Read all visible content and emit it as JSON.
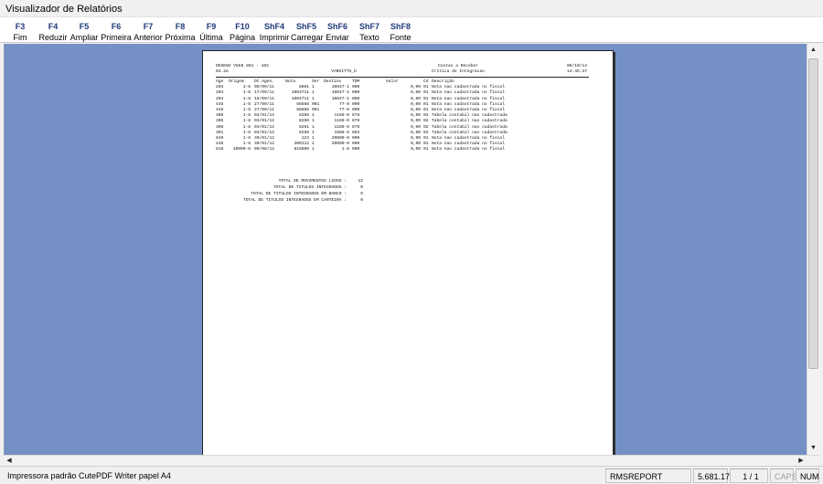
{
  "window": {
    "title": "Visualizador de Relatórios"
  },
  "toolbar": {
    "buttons": [
      {
        "key": "F3",
        "label": "Fim"
      },
      {
        "key": "F4",
        "label": "Reduzir"
      },
      {
        "key": "F5",
        "label": "Ampliar"
      },
      {
        "key": "F6",
        "label": "Primeira"
      },
      {
        "key": "F7",
        "label": "Anterior"
      },
      {
        "key": "F8",
        "label": "Próxima"
      },
      {
        "key": "F9",
        "label": "Última"
      },
      {
        "key": "F10",
        "label": "Página"
      },
      {
        "key": "ShF4",
        "label": "Imprimir"
      },
      {
        "key": "ShF5",
        "label": "Carregar"
      },
      {
        "key": "ShF6",
        "label": "Enviar"
      },
      {
        "key": "ShF7",
        "label": "Texto"
      },
      {
        "key": "ShF8",
        "label": "Fonte"
      }
    ]
  },
  "report": {
    "header": {
      "left1": "DESENV V568 891 - 102",
      "left2": "03.2a",
      "center1": "Contas a Receber",
      "center1b": "VARGITTU_b",
      "center2": "Crítica de Integracao",
      "right1": "06/10/14",
      "right2": "14:45:37"
    },
    "columns": [
      "Age",
      "Origem",
      "Dt.Agen.",
      "Nota",
      "Ser",
      "Destino",
      "TDM",
      "Valor",
      "Cd",
      "Descrição"
    ],
    "rows": [
      [
        "204",
        "1-8",
        "09/09/11",
        "8881",
        "1",
        "10047-1",
        "000",
        "0,00",
        "01",
        "Nota nao cadastrada no fiscal"
      ],
      [
        "204",
        "1-8",
        "17/09/11",
        "1004711",
        "1",
        "10047-1",
        "000",
        "0,00",
        "01",
        "Nota nao cadastrada no fiscal"
      ],
      [
        "204",
        "1-8",
        "18/09/11",
        "1004711",
        "1",
        "10047-1",
        "000",
        "0,00",
        "01",
        "Nota nao cadastrada no fiscal"
      ],
      [
        "448",
        "1-8",
        "27/09/11",
        "88888",
        "001",
        "77-8",
        "000",
        "0,00",
        "01",
        "Nota nao cadastrada no fiscal"
      ],
      [
        "448",
        "1-8",
        "27/09/11",
        "88888",
        "001",
        "77-8",
        "000",
        "0,00",
        "01",
        "Nota nao cadastrada no fiscal"
      ],
      [
        "306",
        "1-8",
        "03/01/12",
        "8288",
        "1",
        "1188-0",
        "878",
        "0,00",
        "02",
        "Tabela contabil nao cadastrada"
      ],
      [
        "306",
        "1-8",
        "03/01/12",
        "8260",
        "1",
        "1188-0",
        "878",
        "0,00",
        "02",
        "Tabela contabil nao cadastrada"
      ],
      [
        "308",
        "1-8",
        "03/01/12",
        "8261",
        "1",
        "1188-0",
        "878",
        "0,00",
        "02",
        "Tabela contabil nao cadastrada"
      ],
      [
        "301",
        "1-8",
        "03/01/12",
        "8288",
        "1",
        "1888-8",
        "882",
        "0,00",
        "02",
        "Tabela contabil nao cadastrada"
      ],
      [
        "848",
        "1-8",
        "30/01/12",
        "123",
        "1",
        "20000-0",
        "000",
        "0,00",
        "01",
        "Nota nao cadastrada no fiscal"
      ],
      [
        "448",
        "1-8",
        "30/01/12",
        "300112",
        "1",
        "20000-0",
        "000",
        "0,00",
        "01",
        "Nota nao cadastrada no fiscal"
      ],
      [
        "818",
        "10000-8",
        "09/08/12",
        "818800",
        "1",
        "1-8",
        "000",
        "0,00",
        "01",
        "Nota nao cadastrada no fiscal"
      ]
    ],
    "totals": [
      {
        "label": "TOTAL DE MOVIMENTOS LIDOS :",
        "value": "12"
      },
      {
        "label": "TOTAL DE TITULOS INTEGRADOS :",
        "value": "0"
      },
      {
        "label": "TOTAL DE TITULOS INTEGRADOS EM BANCO :",
        "value": "0"
      },
      {
        "label": "TOTAL DE TITULOS INTEGRADOS EM CARTEIRA :",
        "value": "0"
      }
    ]
  },
  "statusbar": {
    "printer": "Impressora padrão CutePDF Writer papel A4",
    "module": "RMSREPORT",
    "version": "5.681.17",
    "pages": "1 / 1",
    "caps": "CAPS",
    "num": "NUM"
  }
}
